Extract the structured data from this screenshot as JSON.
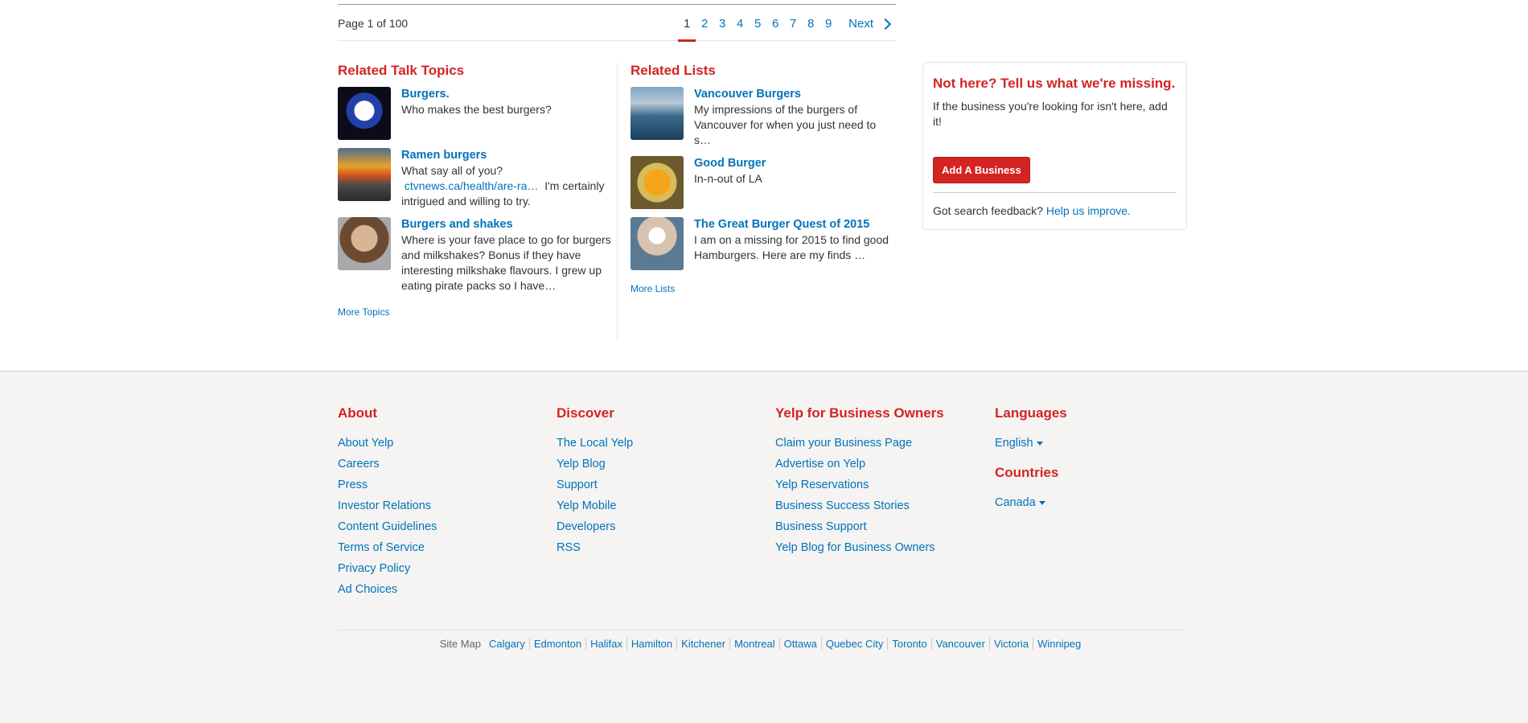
{
  "pagination": {
    "summary": "Page 1 of 100",
    "pages": [
      "1",
      "2",
      "3",
      "4",
      "5",
      "6",
      "7",
      "8",
      "9"
    ],
    "next": "Next"
  },
  "talk": {
    "heading": "Related Talk Topics",
    "items": [
      {
        "title": "Burgers.",
        "text": "Who makes the best burgers?"
      },
      {
        "title": "Ramen burgers",
        "text_before": "What say all of you?",
        "link": "ctvnews.ca/health/are-ra…",
        "text_after": "I'm certainly intrigued and willing to try."
      },
      {
        "title": "Burgers and shakes",
        "text": "Where is your fave place to go for burgers and milkshakes? Bonus if they have interesting milkshake flavours. I grew up eating pirate packs so I have…"
      }
    ],
    "more": "More Topics"
  },
  "lists": {
    "heading": "Related Lists",
    "items": [
      {
        "title": "Vancouver Burgers",
        "text": "My impressions of the burgers of Vancouver for when you just need to s…"
      },
      {
        "title": "Good Burger",
        "text": "In-n-out of LA"
      },
      {
        "title": "The Great Burger Quest of 2015",
        "text": "I am on a missing for 2015 to find good Hamburgers. Here are my finds …"
      }
    ],
    "more": "More Lists"
  },
  "nothere": {
    "heading": "Not here? Tell us what we're missing.",
    "text": "If the business you're looking for isn't here, add it!",
    "button": "Add A Business",
    "feedback": "Got search feedback?",
    "feedback_link": "Help us improve."
  },
  "footer": {
    "about": {
      "heading": "About",
      "links": [
        "About Yelp",
        "Careers",
        "Press",
        "Investor Relations",
        "Content Guidelines",
        "Terms of Service",
        "Privacy Policy",
        "Ad Choices"
      ]
    },
    "discover": {
      "heading": "Discover",
      "links": [
        "The Local Yelp",
        "Yelp Blog",
        "Support",
        "Yelp Mobile",
        "Developers",
        "RSS"
      ]
    },
    "business": {
      "heading": "Yelp for Business Owners",
      "links": [
        "Claim your Business Page",
        "Advertise on Yelp",
        "Yelp Reservations",
        "Business Success Stories",
        "Business Support",
        "Yelp Blog for Business Owners"
      ]
    },
    "languages": {
      "heading": "Languages",
      "value": "English"
    },
    "countries": {
      "heading": "Countries",
      "value": "Canada"
    },
    "sitemap": {
      "label": "Site Map",
      "cities": [
        "Calgary",
        "Edmonton",
        "Halifax",
        "Hamilton",
        "Kitchener",
        "Montreal",
        "Ottawa",
        "Quebec City",
        "Toronto",
        "Vancouver",
        "Victoria",
        "Winnipeg"
      ]
    }
  },
  "colors": {
    "accent": "#d32323",
    "link": "#0073bb",
    "footer_bg": "#f5f4f2"
  }
}
